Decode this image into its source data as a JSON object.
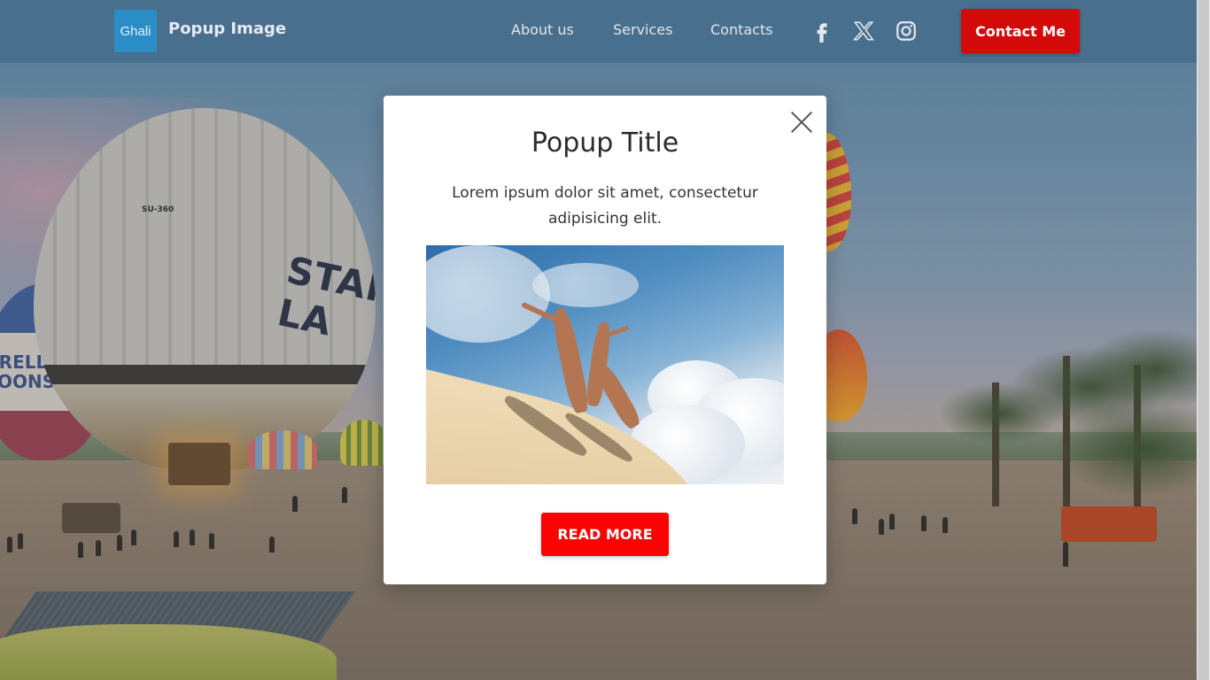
{
  "header": {
    "logo_text": "Ghali",
    "brand_name": "Popup Image",
    "nav_links": [
      {
        "label": "About us"
      },
      {
        "label": "Services"
      },
      {
        "label": "Contacts"
      }
    ],
    "social_icons": [
      "facebook-icon",
      "x-icon",
      "instagram-icon"
    ],
    "cta_label": "Contact Me",
    "cta_color": "#d40a0a"
  },
  "popup": {
    "title": "Popup Title",
    "text": "Lorem ipsum dolor sit amet, consectetur adipisicing elit.",
    "button_label": "READ MORE",
    "button_color": "#fb0303",
    "close_icon": "close-icon"
  },
  "background": {
    "balloon_text_big": "STAR LA",
    "balloon_text_small": "SU-360",
    "balloon_text_left": "ERELLA\nLOONS"
  }
}
